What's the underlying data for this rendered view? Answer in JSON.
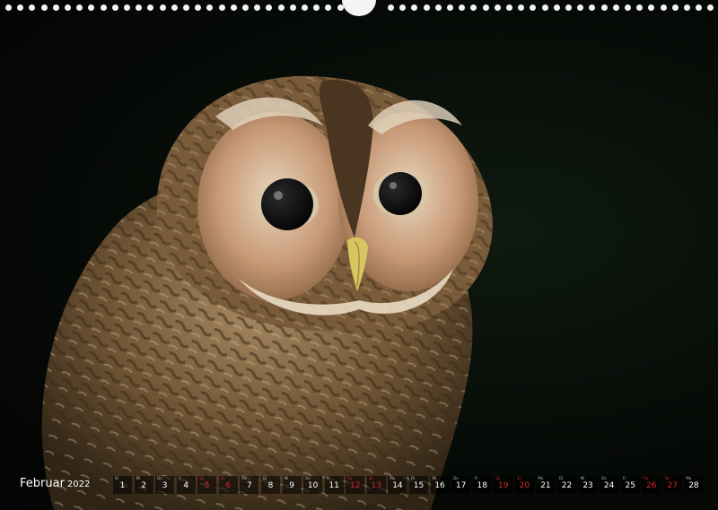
{
  "calendar": {
    "month": "Februar",
    "year": "2022",
    "days": [
      {
        "num": "1",
        "wd": "Di",
        "weekend": false
      },
      {
        "num": "2",
        "wd": "Mi",
        "weekend": false
      },
      {
        "num": "3",
        "wd": "Do",
        "weekend": false
      },
      {
        "num": "4",
        "wd": "Fr",
        "weekend": false
      },
      {
        "num": "5",
        "wd": "Sa",
        "weekend": true
      },
      {
        "num": "6",
        "wd": "So",
        "weekend": true
      },
      {
        "num": "7",
        "wd": "Mo",
        "weekend": false
      },
      {
        "num": "8",
        "wd": "Di",
        "weekend": false
      },
      {
        "num": "9",
        "wd": "Mi",
        "weekend": false
      },
      {
        "num": "10",
        "wd": "Do",
        "weekend": false
      },
      {
        "num": "11",
        "wd": "Fr",
        "weekend": false
      },
      {
        "num": "12",
        "wd": "Sa",
        "weekend": true
      },
      {
        "num": "13",
        "wd": "So",
        "weekend": true
      },
      {
        "num": "14",
        "wd": "Mo",
        "weekend": false
      },
      {
        "num": "15",
        "wd": "Di",
        "weekend": false
      },
      {
        "num": "16",
        "wd": "Mi",
        "weekend": false
      },
      {
        "num": "17",
        "wd": "Do",
        "weekend": false
      },
      {
        "num": "18",
        "wd": "Fr",
        "weekend": false
      },
      {
        "num": "19",
        "wd": "Sa",
        "weekend": true
      },
      {
        "num": "20",
        "wd": "So",
        "weekend": true
      },
      {
        "num": "21",
        "wd": "Mo",
        "weekend": false
      },
      {
        "num": "22",
        "wd": "Di",
        "weekend": false
      },
      {
        "num": "23",
        "wd": "Mi",
        "weekend": false
      },
      {
        "num": "24",
        "wd": "Do",
        "weekend": false
      },
      {
        "num": "25",
        "wd": "Fr",
        "weekend": false
      },
      {
        "num": "26",
        "wd": "Sa",
        "weekend": true
      },
      {
        "num": "27",
        "wd": "So",
        "weekend": true
      },
      {
        "num": "28",
        "wd": "Mo",
        "weekend": false
      }
    ]
  },
  "colors": {
    "background": "#050805",
    "binding": "#f4f4f4",
    "weekend": "#d6262c",
    "text": "#ffffff"
  }
}
